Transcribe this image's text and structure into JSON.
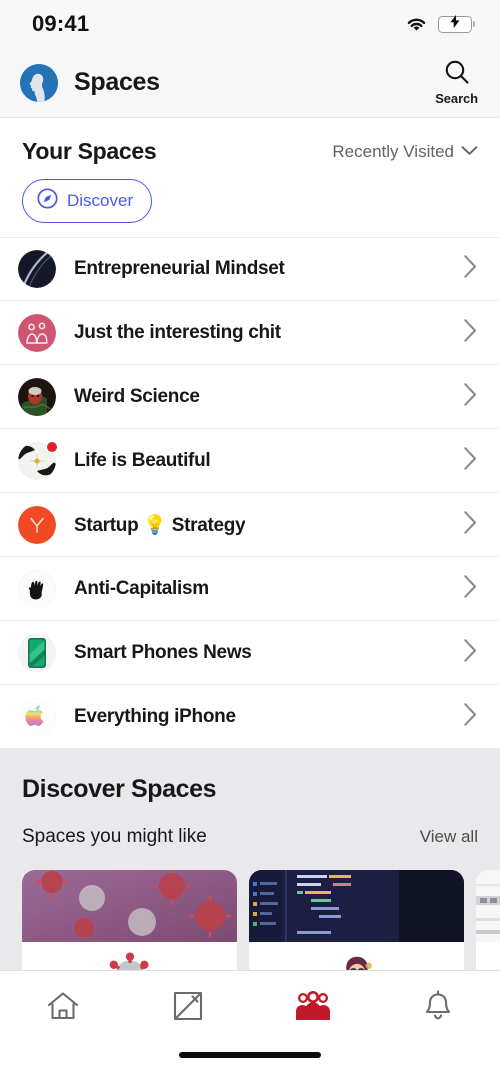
{
  "status_bar": {
    "time": "09:41",
    "wifi_icon": "wifi-icon",
    "battery_icon": "battery-charging-icon",
    "battery_state": "charging"
  },
  "header": {
    "avatar_icon": "user-profile-avatar",
    "title": "Spaces",
    "search_icon": "search-icon",
    "search_label": "Search"
  },
  "your_spaces": {
    "title": "Your Spaces",
    "sort_label": "Recently Visited",
    "sort_chevron_icon": "chevron-down-icon",
    "discover_pill": {
      "label": "Discover",
      "icon": "compass-icon"
    },
    "items": [
      {
        "name": "Entrepreneurial Mindset",
        "avatar_icon": "dark-streak-avatar",
        "badge": false,
        "chevron_icon": "chevron-right-icon"
      },
      {
        "name": "Just the interesting chit",
        "avatar_icon": "pink-figures-avatar",
        "badge": false,
        "chevron_icon": "chevron-right-icon"
      },
      {
        "name": "Weird Science",
        "avatar_icon": "portrait-photo-avatar",
        "badge": false,
        "chevron_icon": "chevron-right-icon"
      },
      {
        "name": "Life is Beautiful",
        "avatar_icon": "flower-photo-avatar",
        "badge": true,
        "chevron_icon": "chevron-right-icon"
      },
      {
        "name": "Startup 💡 Strategy",
        "avatar_icon": "orange-y-avatar",
        "badge": false,
        "chevron_icon": "chevron-right-icon"
      },
      {
        "name": "Anti-Capitalism",
        "avatar_icon": "raised-fist-avatar",
        "badge": false,
        "chevron_icon": "chevron-right-icon"
      },
      {
        "name": "Smart Phones News",
        "avatar_icon": "green-phone-avatar",
        "badge": false,
        "chevron_icon": "chevron-right-icon"
      },
      {
        "name": "Everything iPhone",
        "avatar_icon": "rainbow-apple-avatar",
        "badge": false,
        "chevron_icon": "chevron-right-icon"
      }
    ]
  },
  "discover_spaces": {
    "title": "Discover Spaces",
    "subtitle": "Spaces you might like",
    "view_all_label": "View all",
    "cards": [
      {
        "cover_icon": "coronavirus-cover-image",
        "avatar_icon": "virus-avatar"
      },
      {
        "cover_icon": "code-editor-cover-image",
        "avatar_icon": "developer-avatar"
      },
      {
        "cover_icon": "laptop-cover-image",
        "avatar_icon": ""
      }
    ]
  },
  "tabbar": {
    "items": [
      {
        "icon": "home-icon",
        "active": false
      },
      {
        "icon": "compose-icon",
        "active": false
      },
      {
        "icon": "spaces-people-icon",
        "active": true
      },
      {
        "icon": "bell-icon",
        "active": false
      }
    ],
    "active_color": "#c2182b",
    "inactive_color": "#6b6b6b"
  },
  "home_indicator": {
    "icon": "home-indicator-bar"
  }
}
